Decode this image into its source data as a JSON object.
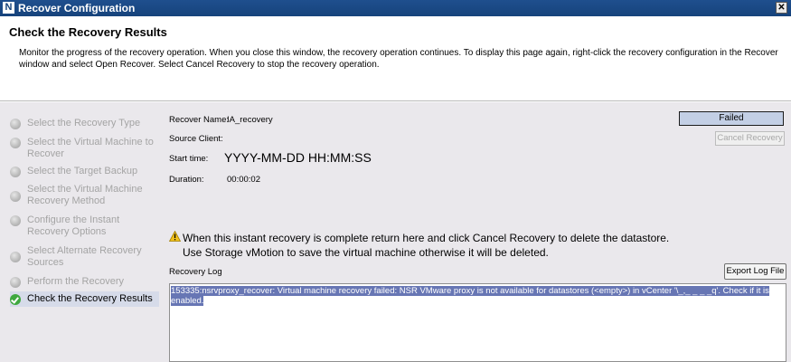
{
  "window": {
    "title": "Recover Configuration",
    "app_icon": "N"
  },
  "header": {
    "heading": "Check the Recovery Results",
    "description": "Monitor the progress of the recovery operation. When you close this window, the recovery operation continues. To display this page again, right-click the recovery configuration in the Recover window and select Open Recover. Select Cancel Recovery to stop the recovery operation."
  },
  "wizard": {
    "steps": [
      {
        "label": "Select the Recovery Type",
        "state": "done"
      },
      {
        "label": "Select the Virtual Machine to Recover",
        "state": "done"
      },
      {
        "label": "Select the Target Backup",
        "state": "done"
      },
      {
        "label": "Select the Virtual Machine Recovery Method",
        "state": "done"
      },
      {
        "label": "Configure the Instant Recovery Options",
        "state": "done"
      },
      {
        "label": "Select Alternate Recovery Sources",
        "state": "done"
      },
      {
        "label": "Perform the Recovery",
        "state": "done"
      },
      {
        "label": "Check the Recovery Results",
        "state": "current"
      }
    ]
  },
  "details": {
    "recover_name_label": "Recover Name:",
    "recover_name_value": "IA_recovery",
    "source_client_label": "Source Client:",
    "start_time_label": "Start time:",
    "start_time_value": "YYYY-MM-DD HH:MM:SS",
    "duration_label": "Duration:",
    "duration_value": "00:00:02"
  },
  "status": {
    "text": "Failed"
  },
  "buttons": {
    "cancel_recovery": "Cancel Recovery",
    "export_log": "Export Log File"
  },
  "warning": {
    "line1": "When this instant recovery is complete return here and click Cancel Recovery to delete the datastore.",
    "line2": "Use Storage vMotion to save the virtual machine otherwise it will be deleted."
  },
  "log": {
    "label": "Recovery Log",
    "text": "153335:nsrvproxy_recover: Virtual machine recovery failed: NSR VMware proxy is not available for datastores (<empty>) in vCenter '\\_,_ _ _ _q'. Check if it is enabled."
  },
  "colors": {
    "titlebar": "#1f4f8e",
    "panel": "#eae8ec",
    "status_fill": "#c3cfe5",
    "selection": "#6776b4",
    "success": "#3fa83f"
  }
}
